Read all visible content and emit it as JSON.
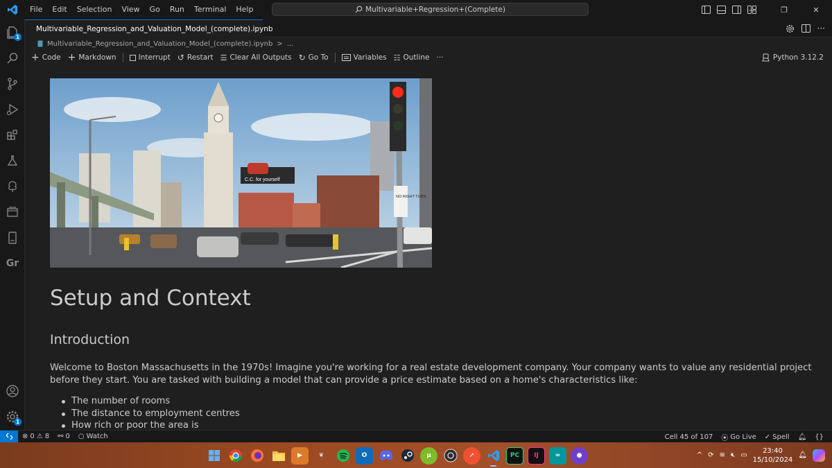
{
  "menu": [
    "File",
    "Edit",
    "Selection",
    "View",
    "Go",
    "Run",
    "Terminal",
    "Help"
  ],
  "command_center": "Multivariable+Regression+(Complete)",
  "tab": {
    "filename": "Multivariable_Regression_and_Valuation_Model_(complete).ipynb",
    "modified": true
  },
  "breadcrumb": {
    "file": "Multivariable_Regression_and_Valuation_Model_(complete).ipynb",
    "more": "..."
  },
  "toolbar": {
    "code": "Code",
    "markdown": "Markdown",
    "interrupt": "Interrupt",
    "restart": "Restart",
    "clear_outputs": "Clear All Outputs",
    "goto": "Go To",
    "variables": "Variables",
    "outline": "Outline",
    "more": "···",
    "kernel": "Python 3.12.2"
  },
  "activity": {
    "explorer_badge": "1",
    "manage_badge": "1",
    "gr_label": "Gr"
  },
  "notebook": {
    "image_alt": "Boston 1970s street scene with clock tower",
    "billboard_text": "C.C. for yourself",
    "sign_text": "NO RIGHT TURN",
    "heading1": "Setup and Context",
    "heading2": "Introduction",
    "paragraph": "Welcome to Boston Massachusetts in the 1970s! Imagine you're working for a real estate development company. Your company wants to value any residential project before they start. You are tasked with building a model that can provide a price estimate based on a home's characteristics like:",
    "bullets": [
      "The number of rooms",
      "The distance to employment centres",
      "How rich or poor the area is"
    ]
  },
  "status": {
    "errors": "0",
    "warnings": "8",
    "ports": "0",
    "watch": "Watch",
    "cell": "Cell 45 of 107",
    "golive": "Go Live",
    "spell": "Spell",
    "braces": "{}"
  },
  "taskbar": {
    "time": "23:40",
    "date": "15/10/2024"
  },
  "colors": {
    "accent": "#0078d4",
    "editor_bg": "#1f1f1f",
    "chrome_bg": "#181818"
  }
}
